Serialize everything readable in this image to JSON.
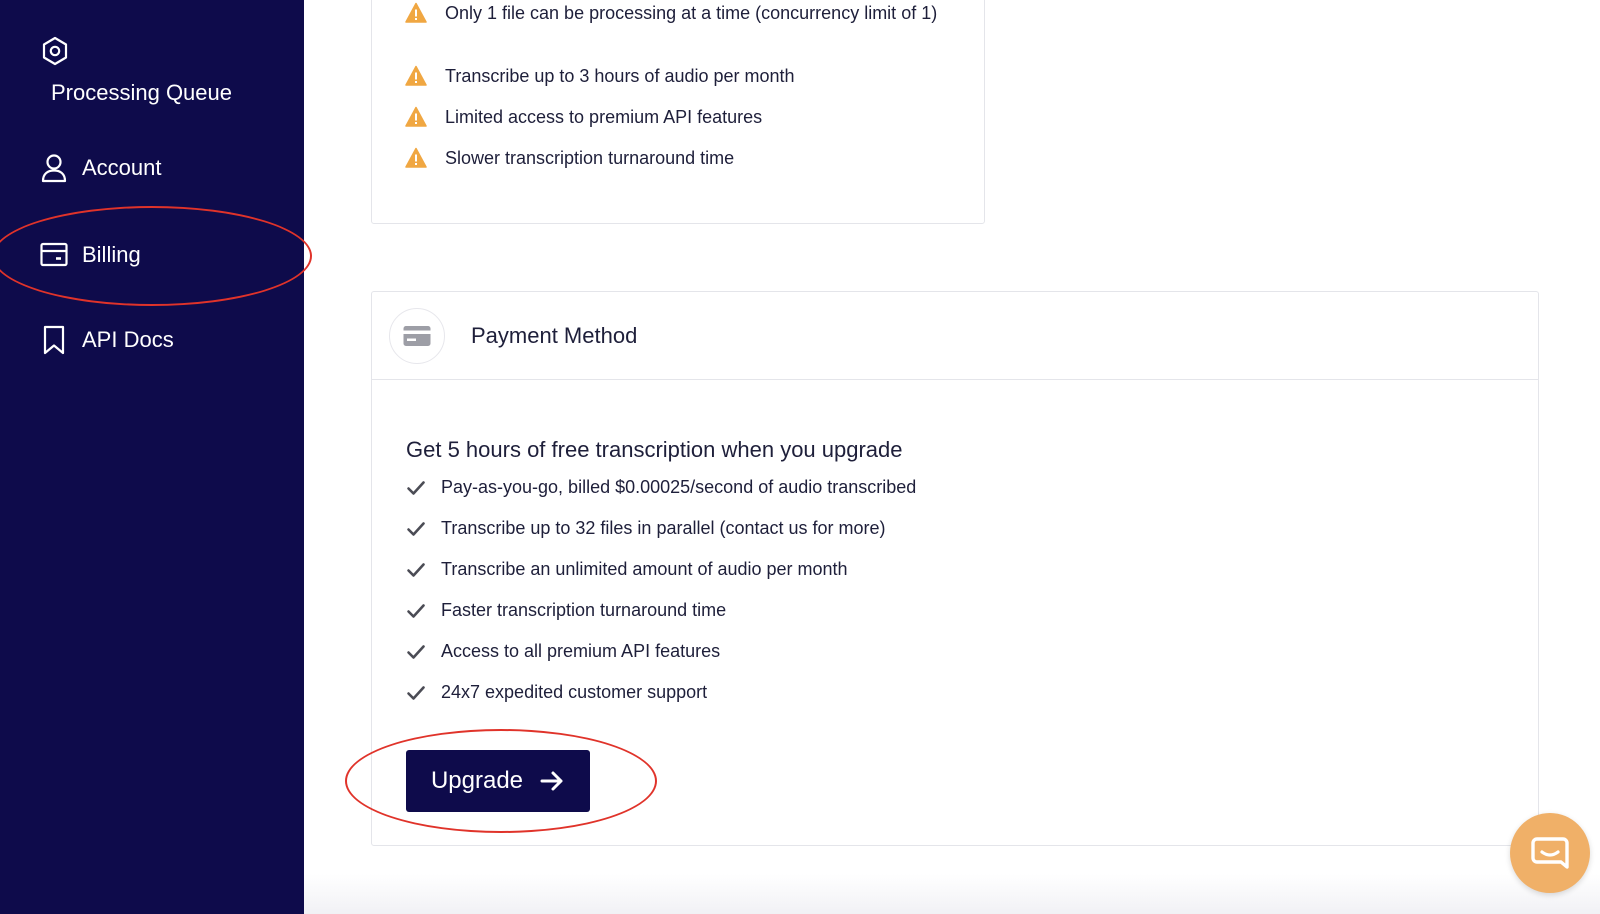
{
  "sidebar": {
    "processing_queue": "Processing Queue",
    "items": [
      {
        "label": "Account",
        "icon": "user-icon"
      },
      {
        "label": "Billing",
        "icon": "billing-card-icon"
      },
      {
        "label": "API Docs",
        "icon": "bookmark-icon"
      }
    ],
    "background": "#0e0b4b"
  },
  "free_plan": {
    "limitations": [
      "Only 1 file can be processing at a time (concurrency limit of 1)",
      "Transcribe up to 3 hours of audio per month",
      "Limited access to premium API features",
      "Slower transcription turnaround time"
    ],
    "warning_color": "#f0a742"
  },
  "payment": {
    "title": "Payment Method",
    "promo": "Get 5 hours of free transcription when you upgrade",
    "features": [
      "Pay-as-you-go, billed $0.00025/second of audio transcribed",
      "Transcribe up to 32 files in parallel (contact us for more)",
      "Transcribe an unlimited amount of audio per month",
      "Faster transcription turnaround time",
      "Access to all premium API features",
      "24x7 expedited customer support"
    ],
    "upgrade_label": "Upgrade"
  },
  "annotation_color": "#e0332a",
  "chat_color": "#f0b068"
}
